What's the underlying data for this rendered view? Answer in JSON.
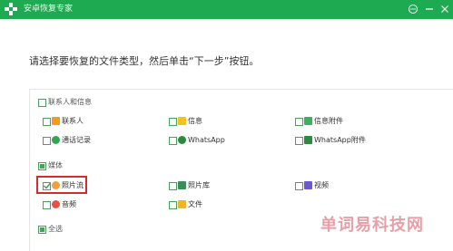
{
  "window": {
    "title": "安卓恢复专家"
  },
  "instruction": "请选择要恢复的文件类型，然后单击“下一步”按钮。",
  "sections": {
    "contacts": {
      "label": "联系人和信息",
      "items": [
        "联系人",
        "信息",
        "信息附件",
        "通话记录",
        "WhatsApp",
        "WhatsApp附件"
      ]
    },
    "media": {
      "label": "媒体",
      "items": [
        "照片流",
        "照片库",
        "视频",
        "音频",
        "文件"
      ]
    },
    "select_all": "全选"
  },
  "watermark": "单词易科技网",
  "colors": {
    "accent": "#1eaa51",
    "highlight": "#d62b2b"
  }
}
